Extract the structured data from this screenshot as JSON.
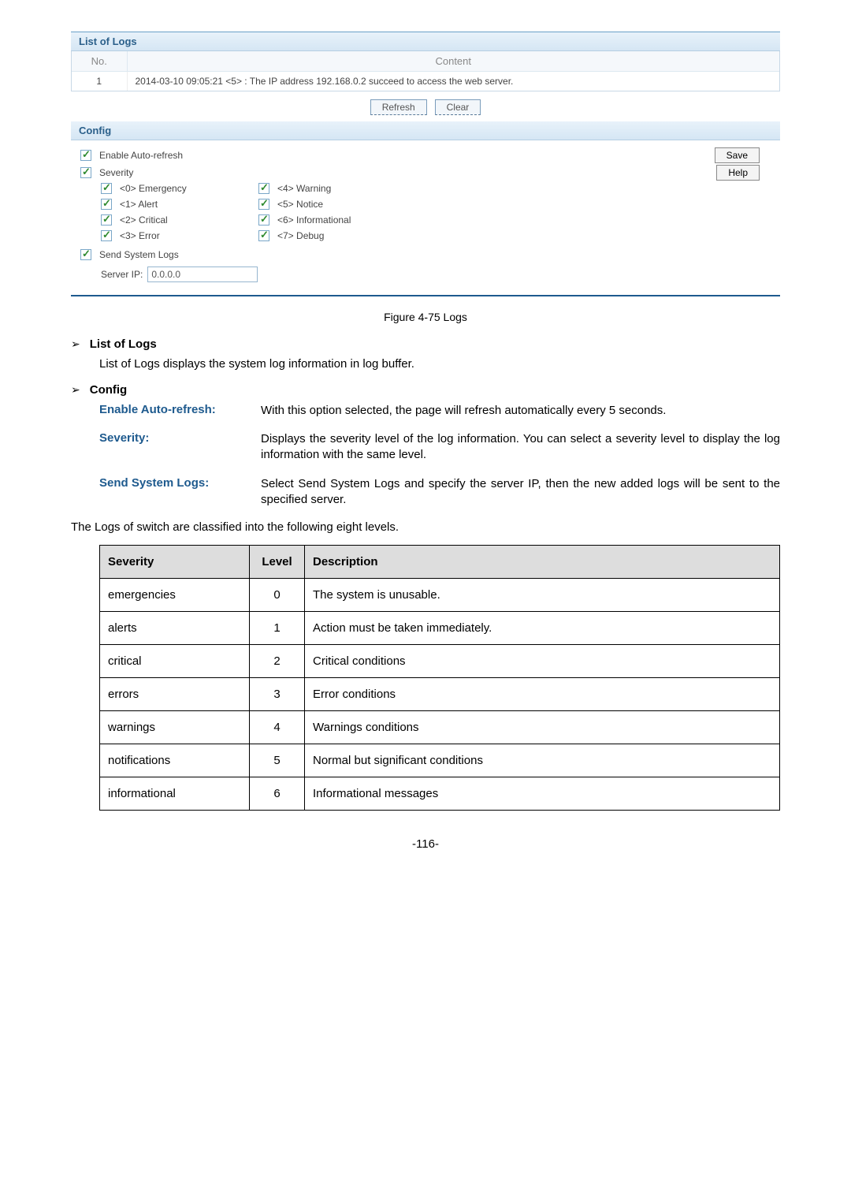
{
  "screenshot": {
    "list_header": "List of Logs",
    "col_no": "No.",
    "col_content": "Content",
    "rows": [
      {
        "no": "1",
        "content": "2014-03-10 09:05:21 <5> : The IP address 192.168.0.2 succeed to access the web server."
      }
    ],
    "btn_refresh": "Refresh",
    "btn_clear": "Clear",
    "config_header": "Config",
    "enable_auto_refresh": "Enable Auto-refresh",
    "severity_label": "Severity",
    "btn_save": "Save",
    "btn_help": "Help",
    "severities_left": [
      "<0> Emergency",
      "<1> Alert",
      "<2> Critical",
      "<3> Error"
    ],
    "severities_right": [
      "<4> Warning",
      "<5> Notice",
      "<6> Informational",
      "<7> Debug"
    ],
    "send_system_logs": "Send System Logs",
    "server_ip_label": "Server IP:",
    "server_ip_value": "0.0.0.0"
  },
  "figure_caption": "Figure 4-75 Logs",
  "section_list_of_logs": {
    "title": "List of Logs",
    "text": "List of Logs displays the system log information in log buffer."
  },
  "section_config": {
    "title": "Config",
    "defs": [
      {
        "term": "Enable Auto-refresh:",
        "desc": "With this option selected, the page will refresh automatically every 5 seconds."
      },
      {
        "term": "Severity:",
        "desc": "Displays the severity level of the log information. You can select a severity level to display the log information with the same level."
      },
      {
        "term": "Send System Logs:",
        "desc": "Select Send System Logs and specify the server IP, then the new added logs will be sent to the specified server."
      }
    ]
  },
  "levels_intro": "The Logs of switch are classified into the following eight levels.",
  "levels_table": {
    "headers": [
      "Severity",
      "Level",
      "Description"
    ],
    "rows": [
      [
        "emergencies",
        "0",
        "The system is unusable."
      ],
      [
        "alerts",
        "1",
        "Action must be taken immediately."
      ],
      [
        "critical",
        "2",
        "Critical conditions"
      ],
      [
        "errors",
        "3",
        "Error conditions"
      ],
      [
        "warnings",
        "4",
        "Warnings conditions"
      ],
      [
        "notifications",
        "5",
        "Normal but significant conditions"
      ],
      [
        "informational",
        "6",
        "Informational messages"
      ]
    ]
  },
  "page_number": "-116-"
}
